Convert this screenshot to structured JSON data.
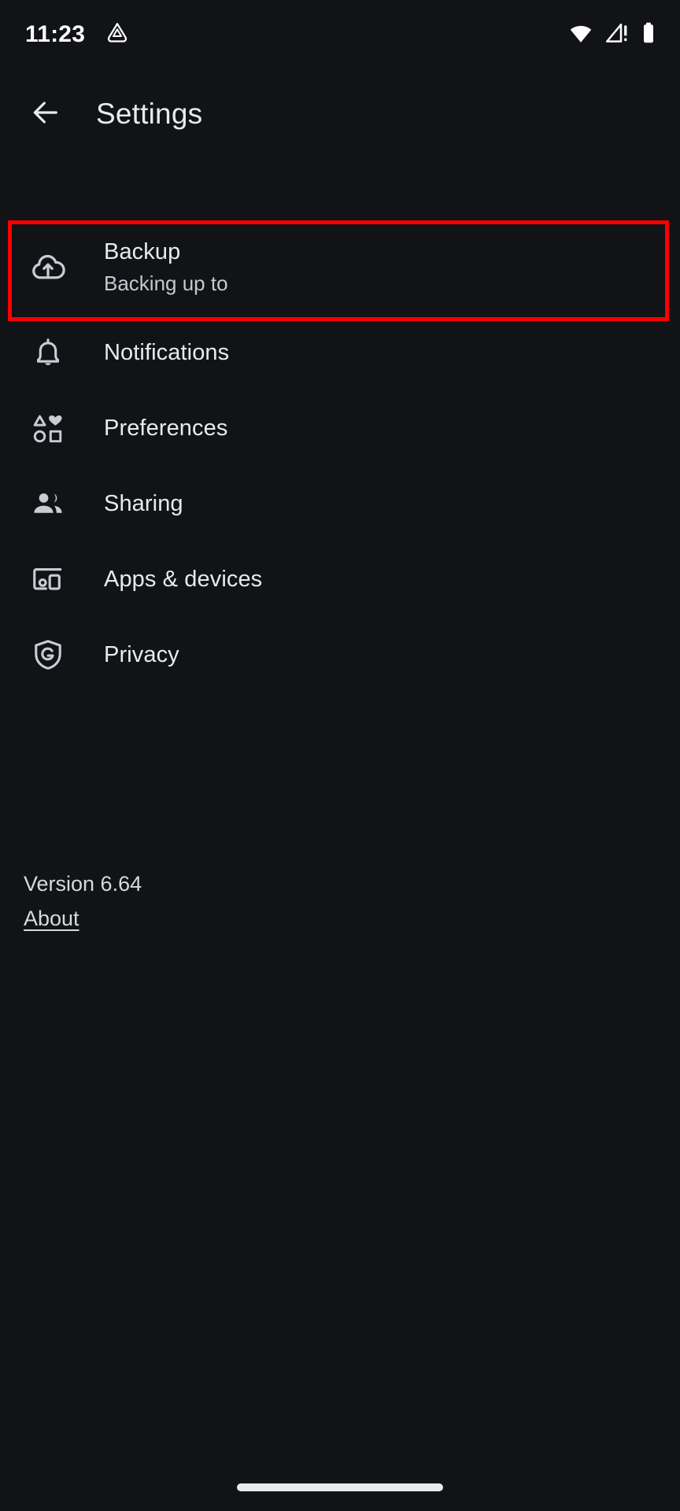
{
  "status_bar": {
    "time": "11:23",
    "icons": [
      {
        "name": "adb-triangle-icon",
        "label": "debug"
      },
      {
        "name": "wifi-icon",
        "label": "wifi"
      },
      {
        "name": "cellular-no-service-icon",
        "label": "no-signal"
      },
      {
        "name": "battery-icon",
        "label": "battery"
      }
    ]
  },
  "app_bar": {
    "back_icon": "back-arrow-icon",
    "title": "Settings"
  },
  "list": {
    "items": [
      {
        "id": "backup",
        "icon": "cloud-upload-icon",
        "label": "Backup",
        "subtitle": "Backing up to",
        "highlighted": true
      },
      {
        "id": "notifications",
        "icon": "bell-icon",
        "label": "Notifications",
        "subtitle": "",
        "highlighted": false
      },
      {
        "id": "preferences",
        "icon": "shapes-icon",
        "label": "Preferences",
        "subtitle": "",
        "highlighted": false
      },
      {
        "id": "sharing",
        "icon": "people-icon",
        "label": "Sharing",
        "subtitle": "",
        "highlighted": false
      },
      {
        "id": "apps-devices",
        "icon": "devices-icon",
        "label": "Apps & devices",
        "subtitle": "",
        "highlighted": false
      },
      {
        "id": "privacy",
        "icon": "shield-g-icon",
        "label": "Privacy",
        "subtitle": "",
        "highlighted": false
      }
    ]
  },
  "footer": {
    "version": "Version 6.64",
    "about_label": "About"
  },
  "colors": {
    "background": "#121317",
    "text_primary": "#e8eaee",
    "text_secondary": "#c6c9cf",
    "icon": "#c9ccd2",
    "highlight": "#fe0000"
  },
  "system": {
    "gesture_bar": "home-gesture-indicator"
  }
}
